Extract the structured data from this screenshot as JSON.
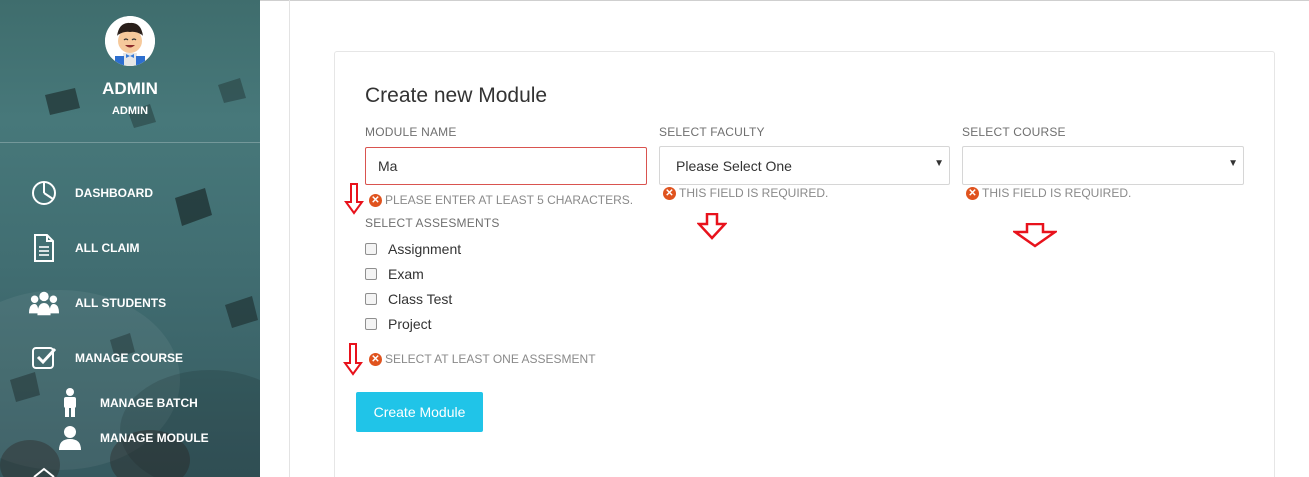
{
  "sidebar": {
    "profile": {
      "name": "ADMIN",
      "role": "ADMIN",
      "avatar_icon": "cartoon-avatar"
    },
    "items": [
      {
        "label": "DASHBOARD",
        "icon": "pie-chart-icon"
      },
      {
        "label": "ALL CLAIM",
        "icon": "document-icon"
      },
      {
        "label": "ALL STUDENTS",
        "icon": "users-icon"
      },
      {
        "label": "MANAGE COURSE",
        "icon": "checkbox-icon"
      },
      {
        "label": "MANAGE BATCH",
        "icon": "person-icon"
      },
      {
        "label": "MANAGE MODULE",
        "icon": "user-icon"
      }
    ]
  },
  "form": {
    "title": "Create new Module",
    "module_name": {
      "label": "MODULE NAME",
      "value": "Ma",
      "error": "PLEASE ENTER AT LEAST 5 CHARACTERS."
    },
    "faculty": {
      "label": "SELECT FACULTY",
      "selected": "Please Select One",
      "error": "THIS FIELD IS REQUIRED."
    },
    "course": {
      "label": "SELECT COURSE",
      "selected": "",
      "error": "THIS FIELD IS REQUIRED."
    },
    "assessments": {
      "label": "SELECT ASSESMENTS",
      "options": [
        "Assignment",
        "Exam",
        "Class Test",
        "Project"
      ],
      "error": "SELECT AT LEAST ONE ASSESMENT"
    },
    "submit_label": "Create Module"
  },
  "colors": {
    "accent": "#20c4e8",
    "error_icon": "#e0531e",
    "error_border": "#d9534f",
    "annotation_arrow": "#e8121c"
  }
}
